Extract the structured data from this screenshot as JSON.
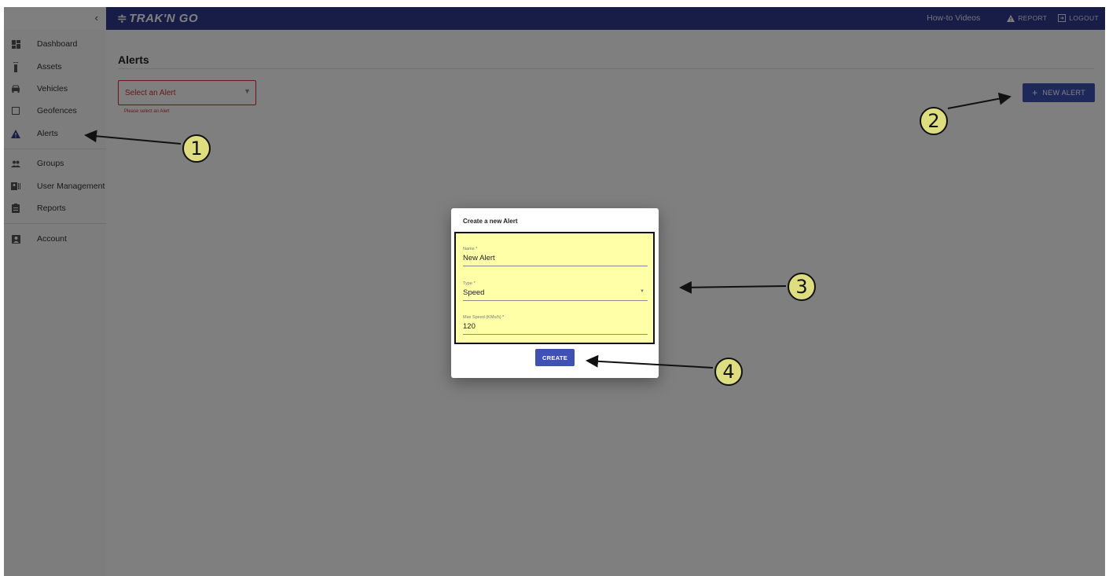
{
  "app": {
    "brand": "TRAK'N GO",
    "collapse_icon": "chevron-left-icon"
  },
  "topbar": {
    "howto": "How-to Videos",
    "report": "REPORT",
    "logout": "LOGOUT"
  },
  "sidebar": {
    "items": [
      {
        "label": "Dashboard",
        "icon": "dashboard-icon"
      },
      {
        "label": "Assets",
        "icon": "tracker-icon"
      },
      {
        "label": "Vehicles",
        "icon": "car-icon"
      },
      {
        "label": "Geofences",
        "icon": "square-icon"
      },
      {
        "label": "Alerts",
        "icon": "warning-icon"
      },
      {
        "label": "Groups",
        "icon": "people-icon"
      },
      {
        "label": "User Management",
        "icon": "badge-icon"
      },
      {
        "label": "Reports",
        "icon": "clipboard-icon"
      },
      {
        "label": "Account",
        "icon": "account-box-icon"
      }
    ]
  },
  "main": {
    "title": "Alerts",
    "select_placeholder": "Select an Alert",
    "select_helper": "Please select an Alert",
    "new_alert": "NEW ALERT"
  },
  "dialog": {
    "title": "Create a new Alert",
    "name_label": "Name *",
    "name_value": "New Alert",
    "type_label": "Type *",
    "type_value": "Speed",
    "speed_label": "Max Speed (KMs/h) *",
    "speed_value": "120",
    "create": "CREATE"
  },
  "annotations": [
    "1",
    "2",
    "3",
    "4"
  ],
  "colors": {
    "brand": "#2f3a8f",
    "accent": "#3f51b5",
    "error": "#d32f2f",
    "highlight": "#ffffa8",
    "badge": "#dede7e"
  }
}
